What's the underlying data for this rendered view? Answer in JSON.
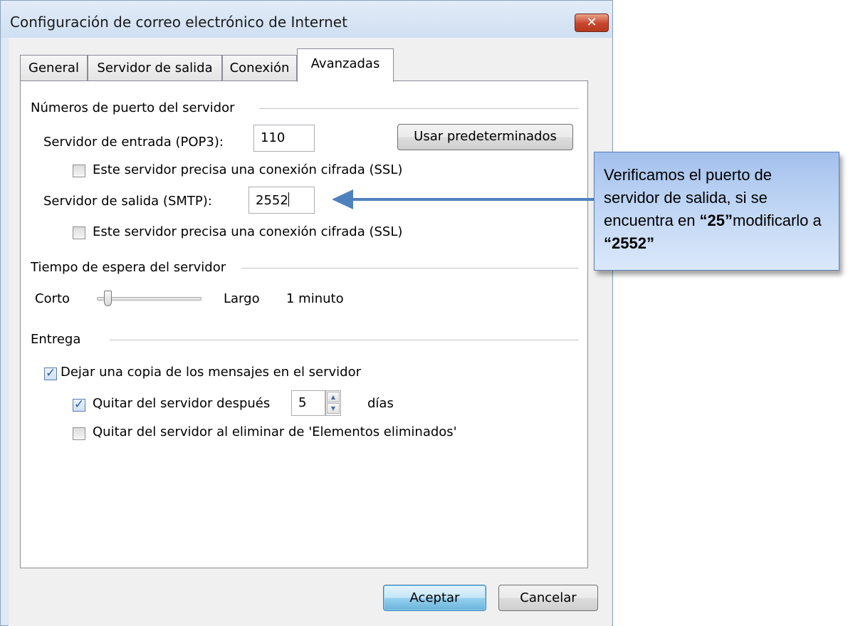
{
  "window": {
    "title": "Configuración de correo electrónico de Internet",
    "close_glyph": "✕"
  },
  "tabs": [
    {
      "label": "General",
      "active": false
    },
    {
      "label": "Servidor de salida",
      "active": false
    },
    {
      "label": "Conexión",
      "active": false
    },
    {
      "label": "Avanzadas",
      "active": true
    }
  ],
  "ports": {
    "group_title": "Números de puerto del servidor",
    "incoming_label": "Servidor de entrada (POP3):",
    "incoming_value": "110",
    "defaults_button": "Usar predeterminados",
    "incoming_ssl_label": "Este servidor precisa una conexión cifrada (SSL)",
    "incoming_ssl_checked": false,
    "outgoing_label": "Servidor de salida (SMTP):",
    "outgoing_value": "2552",
    "outgoing_ssl_label": "Este servidor precisa una conexión cifrada (SSL)",
    "outgoing_ssl_checked": false
  },
  "timeout": {
    "group_title": "Tiempo de espera del servidor",
    "short_label": "Corto",
    "long_label": "Largo",
    "value_text": "1 minuto",
    "slider_level": 0.1
  },
  "delivery": {
    "group_title": "Entrega",
    "leave_copy_label": "Dejar una copia de los mensajes en el servidor",
    "leave_copy_checked": true,
    "remove_after_label": "Quitar del servidor después",
    "remove_after_checked": true,
    "remove_after_days": "5",
    "days_label": "días",
    "remove_deleted_label": "Quitar del servidor al eliminar de 'Elementos eliminados'",
    "remove_deleted_checked": false
  },
  "buttons": {
    "ok": "Aceptar",
    "cancel": "Cancelar"
  },
  "callout": {
    "text_1": "Verificamos el puerto de servidor de salida, si se encuentra en ",
    "bold_1": "“25”",
    "text_2": "modificarlo a ",
    "bold_2": "“2552”"
  },
  "colors": {
    "arrow": "#4f81bd",
    "callout_border": "#5b7fb3"
  }
}
